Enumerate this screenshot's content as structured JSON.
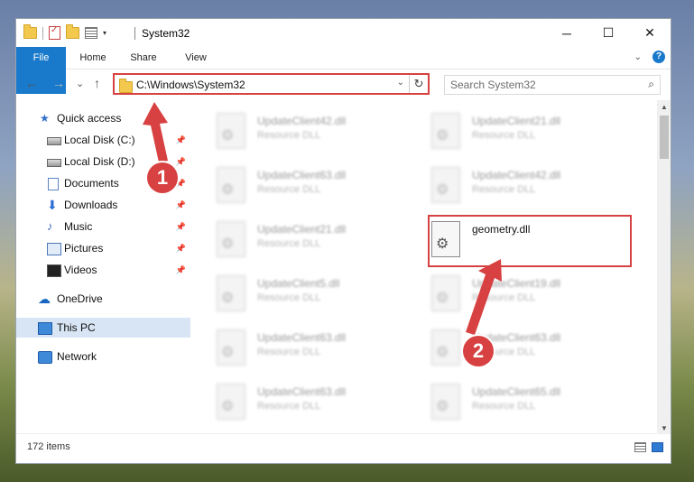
{
  "window": {
    "title": "System32",
    "minimize": "─",
    "maximize": "☐",
    "close": "✕"
  },
  "ribbon": {
    "tabs": [
      "File",
      "Home",
      "Share",
      "View"
    ],
    "help": "?"
  },
  "address": {
    "path": "C:\\Windows\\System32",
    "refresh": "↻"
  },
  "search": {
    "placeholder": "Search System32"
  },
  "nav": {
    "back": "←",
    "forward": "→",
    "recent": "⌄",
    "up": "↑"
  },
  "sidebar": {
    "items": [
      {
        "label": "Quick access",
        "icon": "star-icon"
      },
      {
        "label": "Local Disk (C:)",
        "icon": "disk-icon"
      },
      {
        "label": "Local Disk (D:)",
        "icon": "disk-icon"
      },
      {
        "label": "Documents",
        "icon": "documents-icon"
      },
      {
        "label": "Downloads",
        "icon": "downloads-icon"
      },
      {
        "label": "Music",
        "icon": "music-icon"
      },
      {
        "label": "Pictures",
        "icon": "pictures-icon"
      },
      {
        "label": "Videos",
        "icon": "videos-icon"
      },
      {
        "label": "OneDrive",
        "icon": "onedrive-icon"
      },
      {
        "label": "This PC",
        "icon": "this-pc-icon"
      },
      {
        "label": "Network",
        "icon": "network-icon"
      }
    ],
    "selected": "This PC"
  },
  "files": {
    "left_col": [
      {
        "name": "UpdateClient42.dll",
        "type": "Resource DLL"
      },
      {
        "name": "UpdateClient63.dll",
        "type": "Resource DLL"
      },
      {
        "name": "UpdateClient21.dll",
        "type": "Resource DLL"
      },
      {
        "name": "UpdateClient5.dll",
        "type": "Resource DLL"
      },
      {
        "name": "UpdateClient63.dll",
        "type": "Resource DLL"
      },
      {
        "name": "UpdateClient63.dll",
        "type": "Resource DLL"
      }
    ],
    "right_col": [
      {
        "name": "UpdateClient21.dll",
        "type": "Resource DLL"
      },
      {
        "name": "UpdateClient42.dll",
        "type": "Resource DLL"
      },
      {
        "name": "geometry.dll",
        "type": ""
      },
      {
        "name": "UpdateClient19.dll",
        "type": "Resource DLL"
      },
      {
        "name": "UpdateClient63.dll",
        "type": "Resource DLL"
      },
      {
        "name": "UpdateClient65.dll",
        "type": "Resource DLL"
      }
    ]
  },
  "status": {
    "item_count": "172 items"
  },
  "annotations": {
    "step1": "1",
    "step2": "2",
    "color": "#d84141"
  }
}
